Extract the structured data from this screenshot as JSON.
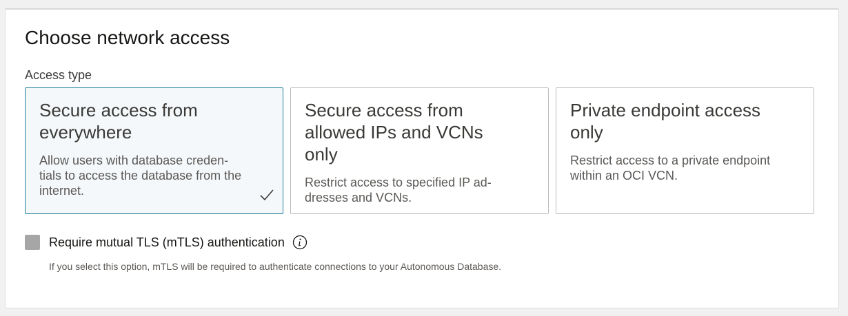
{
  "section": {
    "title": "Choose network access",
    "access_type_label": "Access type"
  },
  "cards": [
    {
      "title": "Secure access from everywhere",
      "description": "Allow users with database creden-tials to access the database from the internet.",
      "selected": true
    },
    {
      "title": "Secure access from allowed IPs and VCNs only",
      "description": "Restrict access to specified IP ad-dresses and VCNs.",
      "selected": false
    },
    {
      "title": "Private endpoint access only",
      "description": "Restrict access to a private endpoint within an OCI VCN.",
      "selected": false
    }
  ],
  "mtls": {
    "label": "Require mutual TLS (mTLS) authentication",
    "checked": false,
    "hint": "If you select this option, mTLS will be required to authenticate connections to your Autonomous Database."
  },
  "icons": {
    "check": "check-icon",
    "info": "info-icon"
  },
  "colors": {
    "selected_border": "#227e9e",
    "selected_background": "#f4f8fb",
    "checkbox_unchecked": "#a6a6a6"
  }
}
